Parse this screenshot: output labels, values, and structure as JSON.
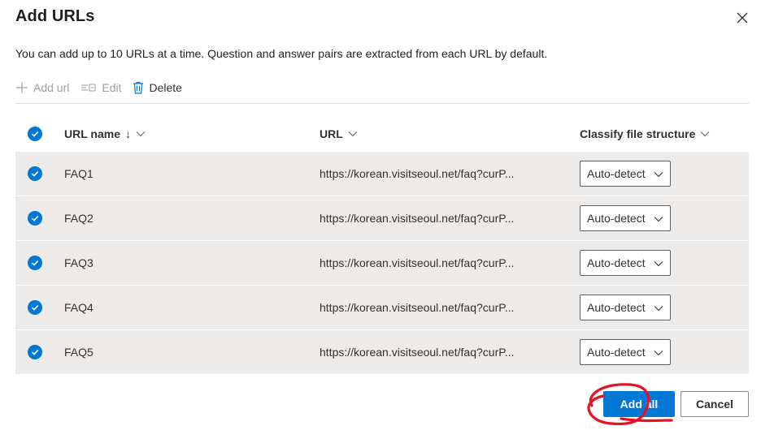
{
  "dialog": {
    "title": "Add URLs",
    "description": "You can add up to 10 URLs at a time. Question and answer pairs are extracted from each URL by default."
  },
  "toolbar": {
    "add_url_label": "Add url",
    "edit_label": "Edit",
    "delete_label": "Delete"
  },
  "table": {
    "columns": {
      "name": "URL name",
      "name_sort": "↓",
      "url": "URL",
      "classify": "Classify file structure"
    },
    "rows": [
      {
        "name": "FAQ1",
        "url": "https://korean.visitseoul.net/faq?curP...",
        "classify": "Auto-detect"
      },
      {
        "name": "FAQ2",
        "url": "https://korean.visitseoul.net/faq?curP...",
        "classify": "Auto-detect"
      },
      {
        "name": "FAQ3",
        "url": "https://korean.visitseoul.net/faq?curP...",
        "classify": "Auto-detect"
      },
      {
        "name": "FAQ4",
        "url": "https://korean.visitseoul.net/faq?curP...",
        "classify": "Auto-detect"
      },
      {
        "name": "FAQ5",
        "url": "https://korean.visitseoul.net/faq?curP...",
        "classify": "Auto-detect"
      }
    ]
  },
  "footer": {
    "add_all_label": "Add all",
    "cancel_label": "Cancel"
  },
  "colors": {
    "accent": "#0078d4",
    "annotation": "#e81123",
    "row_background": "#edebe9"
  },
  "icons": [
    "close-icon",
    "plus-icon",
    "edit-icon",
    "trash-icon",
    "check-icon",
    "chevron-down-icon"
  ]
}
